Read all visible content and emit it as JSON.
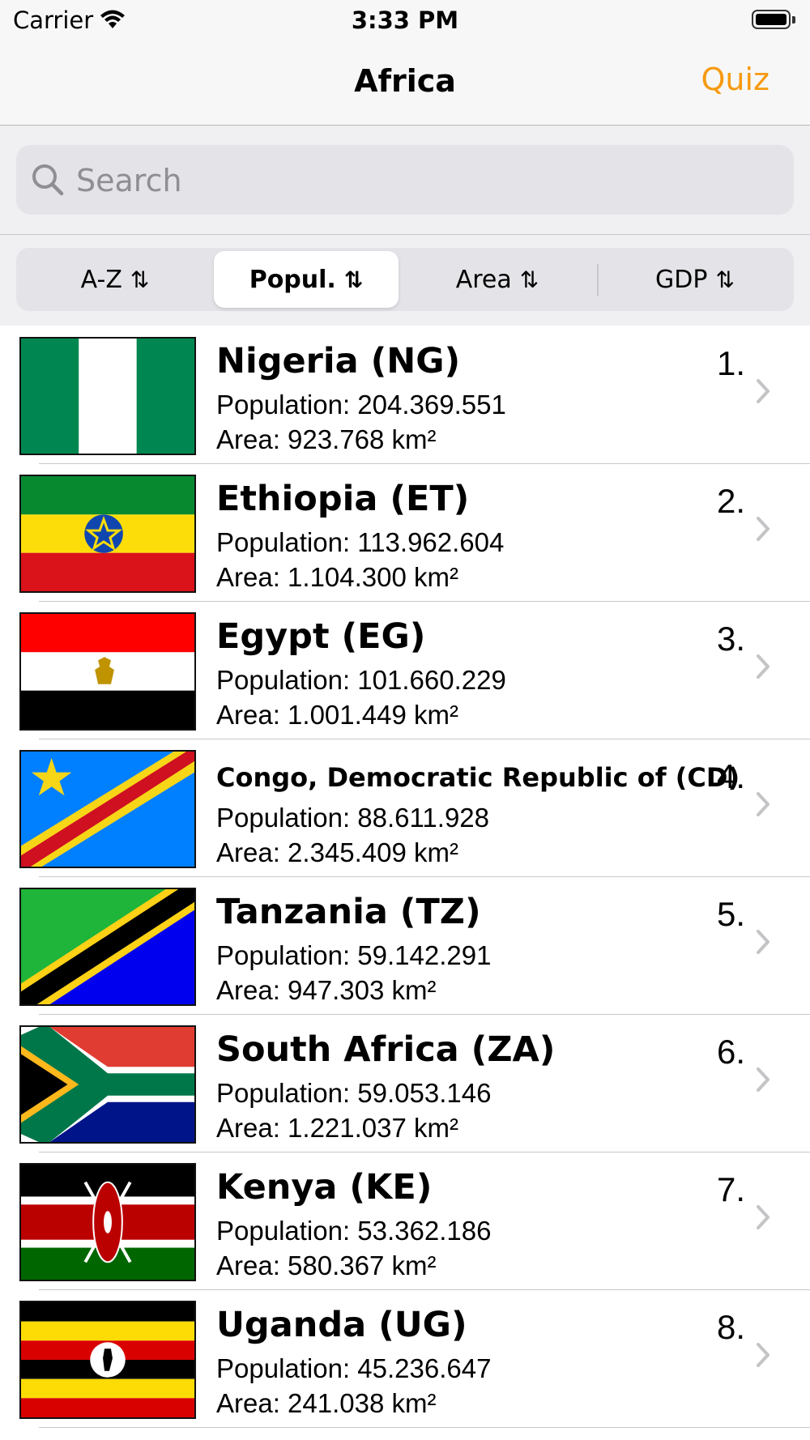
{
  "status_bar": {
    "carrier": "Carrier",
    "time": "3:33 PM"
  },
  "nav": {
    "title": "Africa",
    "quiz_label": "Quiz",
    "accent_color": "#f79a10"
  },
  "search": {
    "placeholder": "Search",
    "value": ""
  },
  "sort_tabs": [
    {
      "label": "A-Z",
      "selected": false
    },
    {
      "label": "Popul.",
      "selected": true
    },
    {
      "label": "Area",
      "selected": false
    },
    {
      "label": "GDP",
      "selected": false
    }
  ],
  "countries": [
    {
      "name": "Nigeria (NG)",
      "population": "Population: 204.369.551",
      "area": "Area: 923.768 km²",
      "rank": "1."
    },
    {
      "name": "Ethiopia (ET)",
      "population": "Population: 113.962.604",
      "area": "Area: 1.104.300 km²",
      "rank": "2."
    },
    {
      "name": "Egypt (EG)",
      "population": "Population: 101.660.229",
      "area": "Area: 1.001.449 km²",
      "rank": "3."
    },
    {
      "name": "Congo, Democratic Republic of (CD)",
      "population": "Population: 88.611.928",
      "area": "Area: 2.345.409 km²",
      "rank": "4."
    },
    {
      "name": "Tanzania (TZ)",
      "population": "Population: 59.142.291",
      "area": "Area: 947.303 km²",
      "rank": "5."
    },
    {
      "name": "South Africa (ZA)",
      "population": "Population: 59.053.146",
      "area": "Area: 1.221.037 km²",
      "rank": "6."
    },
    {
      "name": "Kenya (KE)",
      "population": "Population: 53.362.186",
      "area": "Area: 580.367 km²",
      "rank": "7."
    },
    {
      "name": "Uganda (UG)",
      "population": "Population: 45.236.647",
      "area": "Area: 241.038 km²",
      "rank": "8."
    }
  ]
}
